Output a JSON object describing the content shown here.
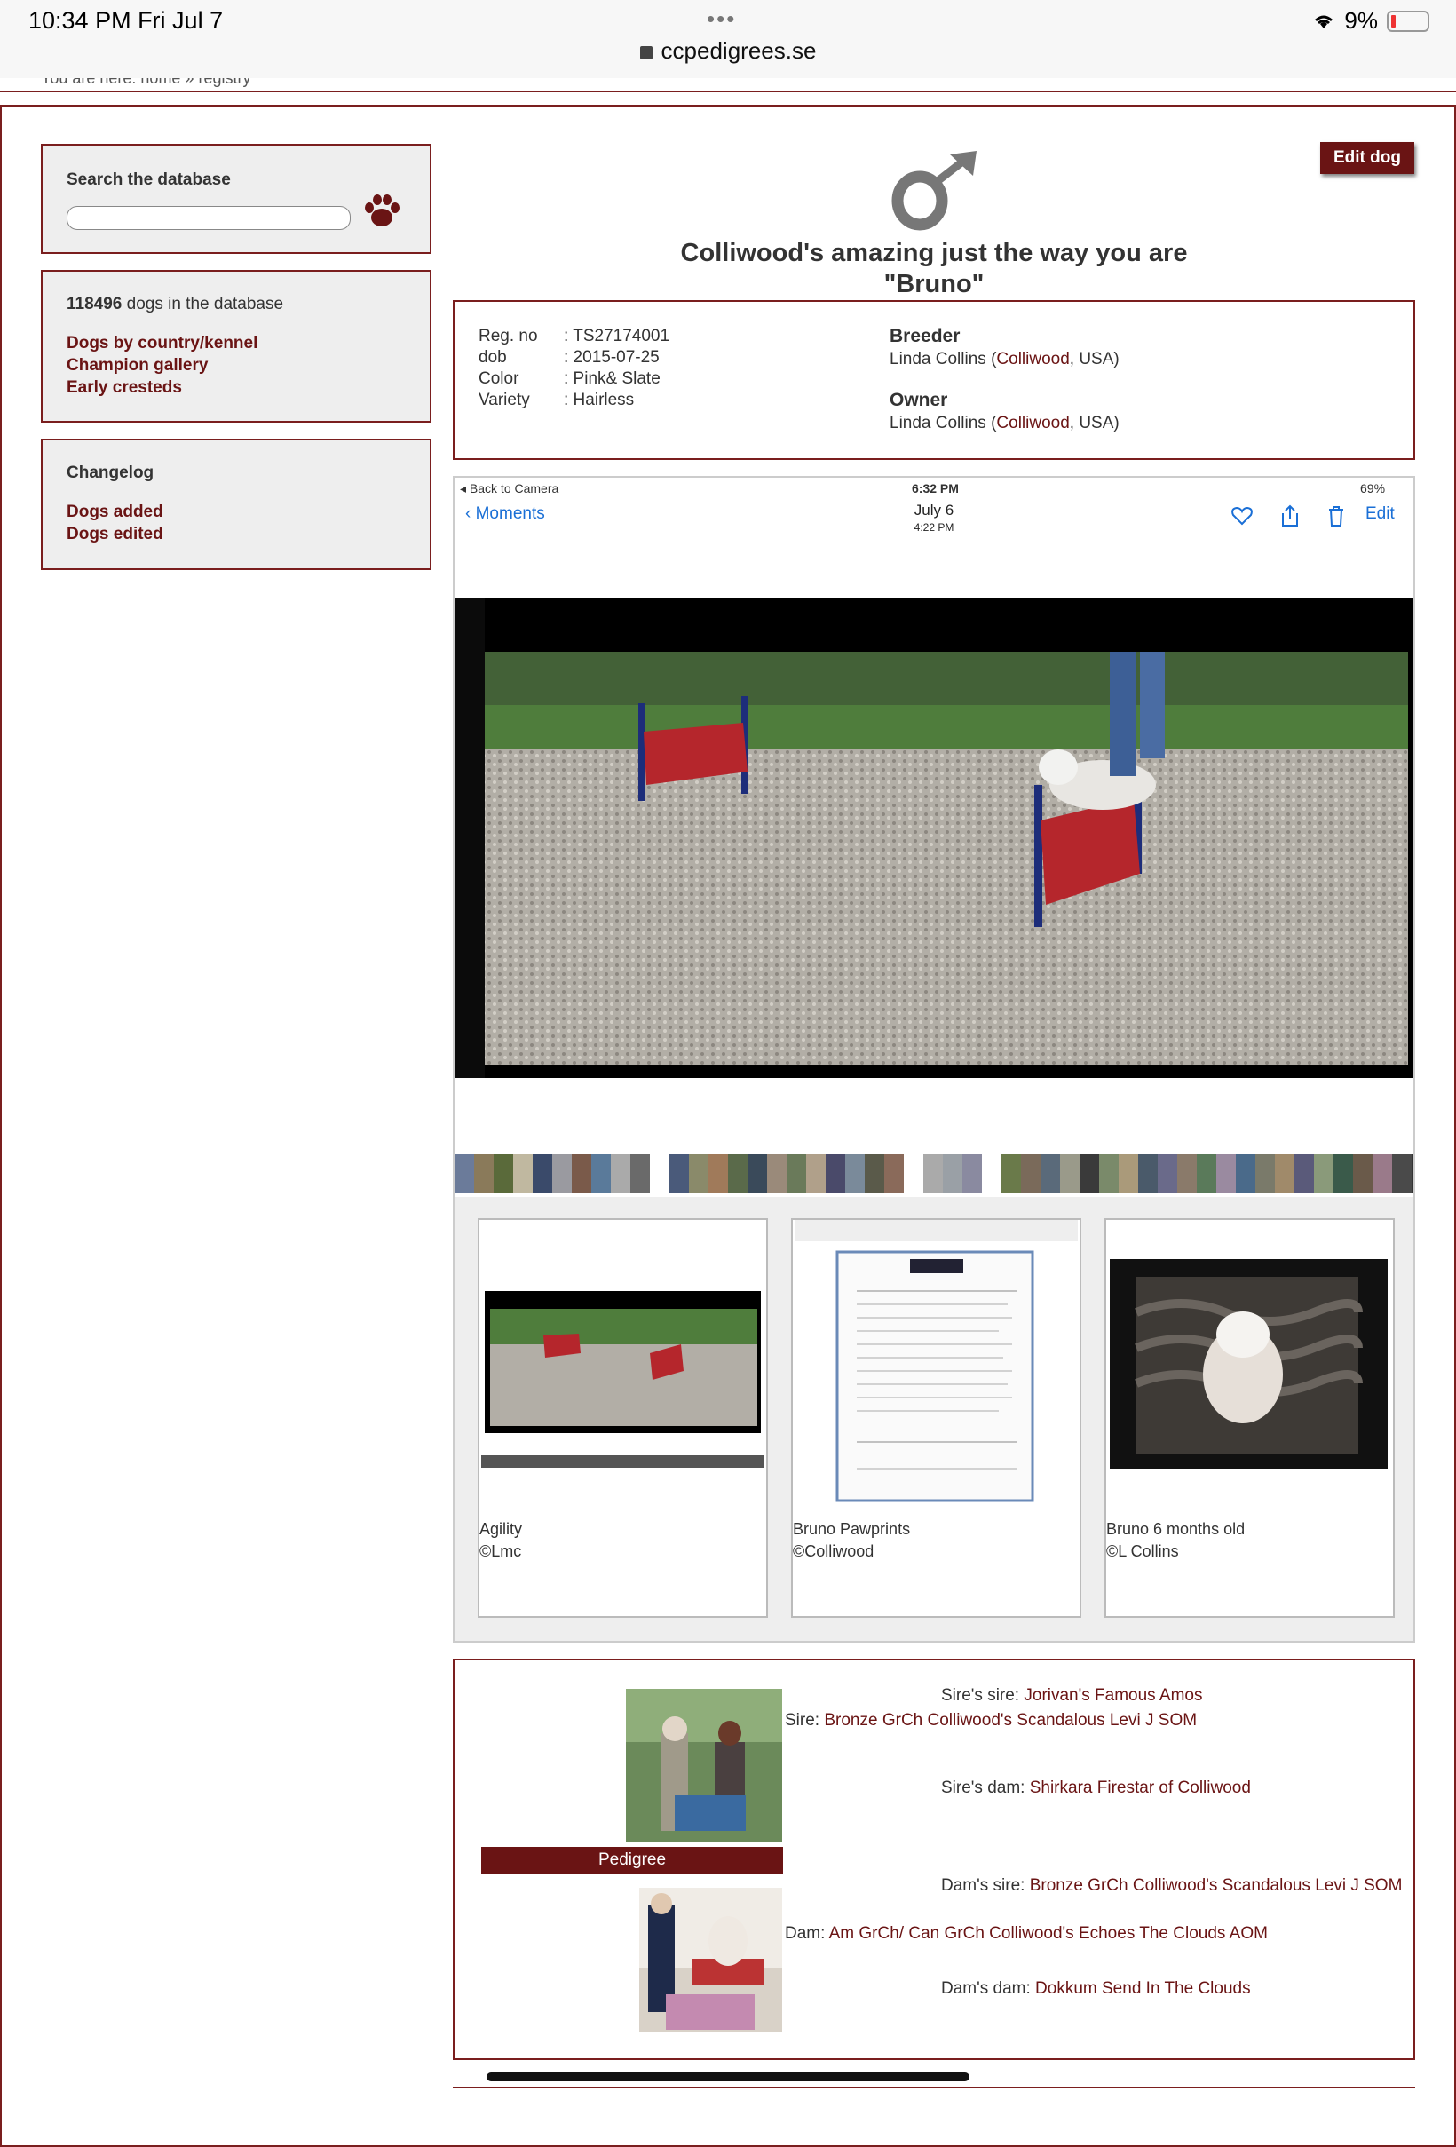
{
  "status_bar": {
    "time": "10:34 PM   Fri Jul 7",
    "dots": "•••",
    "url": "ccpedigrees.se",
    "battery": "9%"
  },
  "breadcrumb": "You are here: home » registry",
  "sidebar": {
    "search_title": "Search the database",
    "search_value": "",
    "dog_count": "118496",
    "dog_count_suffix": " dogs in the database",
    "links": [
      "Dogs by country/kennel",
      "Champion gallery",
      "Early cresteds"
    ],
    "changelog_title": "Changelog",
    "changelog_links": [
      "Dogs added",
      "Dogs edited"
    ]
  },
  "dog": {
    "edit_label": "Edit dog",
    "gender_symbol": "male-symbol-icon",
    "title_line1": "Colliwood's amazing just the way you are",
    "title_line2": "\"Bruno\"",
    "info": [
      {
        "key": "Reg. no",
        "value": ": TS27174001"
      },
      {
        "key": "dob",
        "value": ": 2015-07-25"
      },
      {
        "key": "Color",
        "value": ": Pink& Slate"
      },
      {
        "key": "Variety",
        "value": ": Hairless"
      }
    ],
    "breeder_label": "Breeder",
    "breeder_name": "Linda Collins (",
    "breeder_kennel": "Colliwood",
    "breeder_country": ", USA)",
    "owner_label": "Owner",
    "owner_name": "Linda Collins (",
    "owner_kennel": "Colliwood",
    "owner_country": ", USA)"
  },
  "photo": {
    "back_label": "◂ Back to Camera",
    "time": "6:32 PM",
    "battery": "69%",
    "moments_label": "Moments",
    "date": "July 6",
    "date_time": "4:22 PM",
    "edit_label": "Edit"
  },
  "thumbnails": [
    {
      "caption": "Agility",
      "credit": "©Lmc"
    },
    {
      "caption": "Bruno Pawprints",
      "credit": "©Colliwood"
    },
    {
      "caption": "Bruno 6 months old",
      "credit": "©L Collins"
    }
  ],
  "pedigree": {
    "button_label": "Pedigree",
    "sire_sire_label": "Sire's sire: ",
    "sire_sire": "Jorivan's Famous Amos",
    "sire_label": "Sire: ",
    "sire": "Bronze GrCh Colliwood's Scandalous Levi J SOM",
    "sire_dam_label": "Sire's dam: ",
    "sire_dam": "Shirkara Firestar of Colliwood",
    "dam_sire_label": "Dam's sire: ",
    "dam_sire": "Bronze GrCh Colliwood's Scandalous Levi J SOM",
    "dam_label": "Dam: ",
    "dam": "Am GrCh/ Can GrCh Colliwood's Echoes The Clouds AOM",
    "dam_dam_label": "Dam's dam: ",
    "dam_dam": "Dokkum Send In The Clouds"
  },
  "colors": {
    "brand": "#6a1414",
    "border": "#7a1e1e",
    "link_blue": "#1a6fd6"
  }
}
